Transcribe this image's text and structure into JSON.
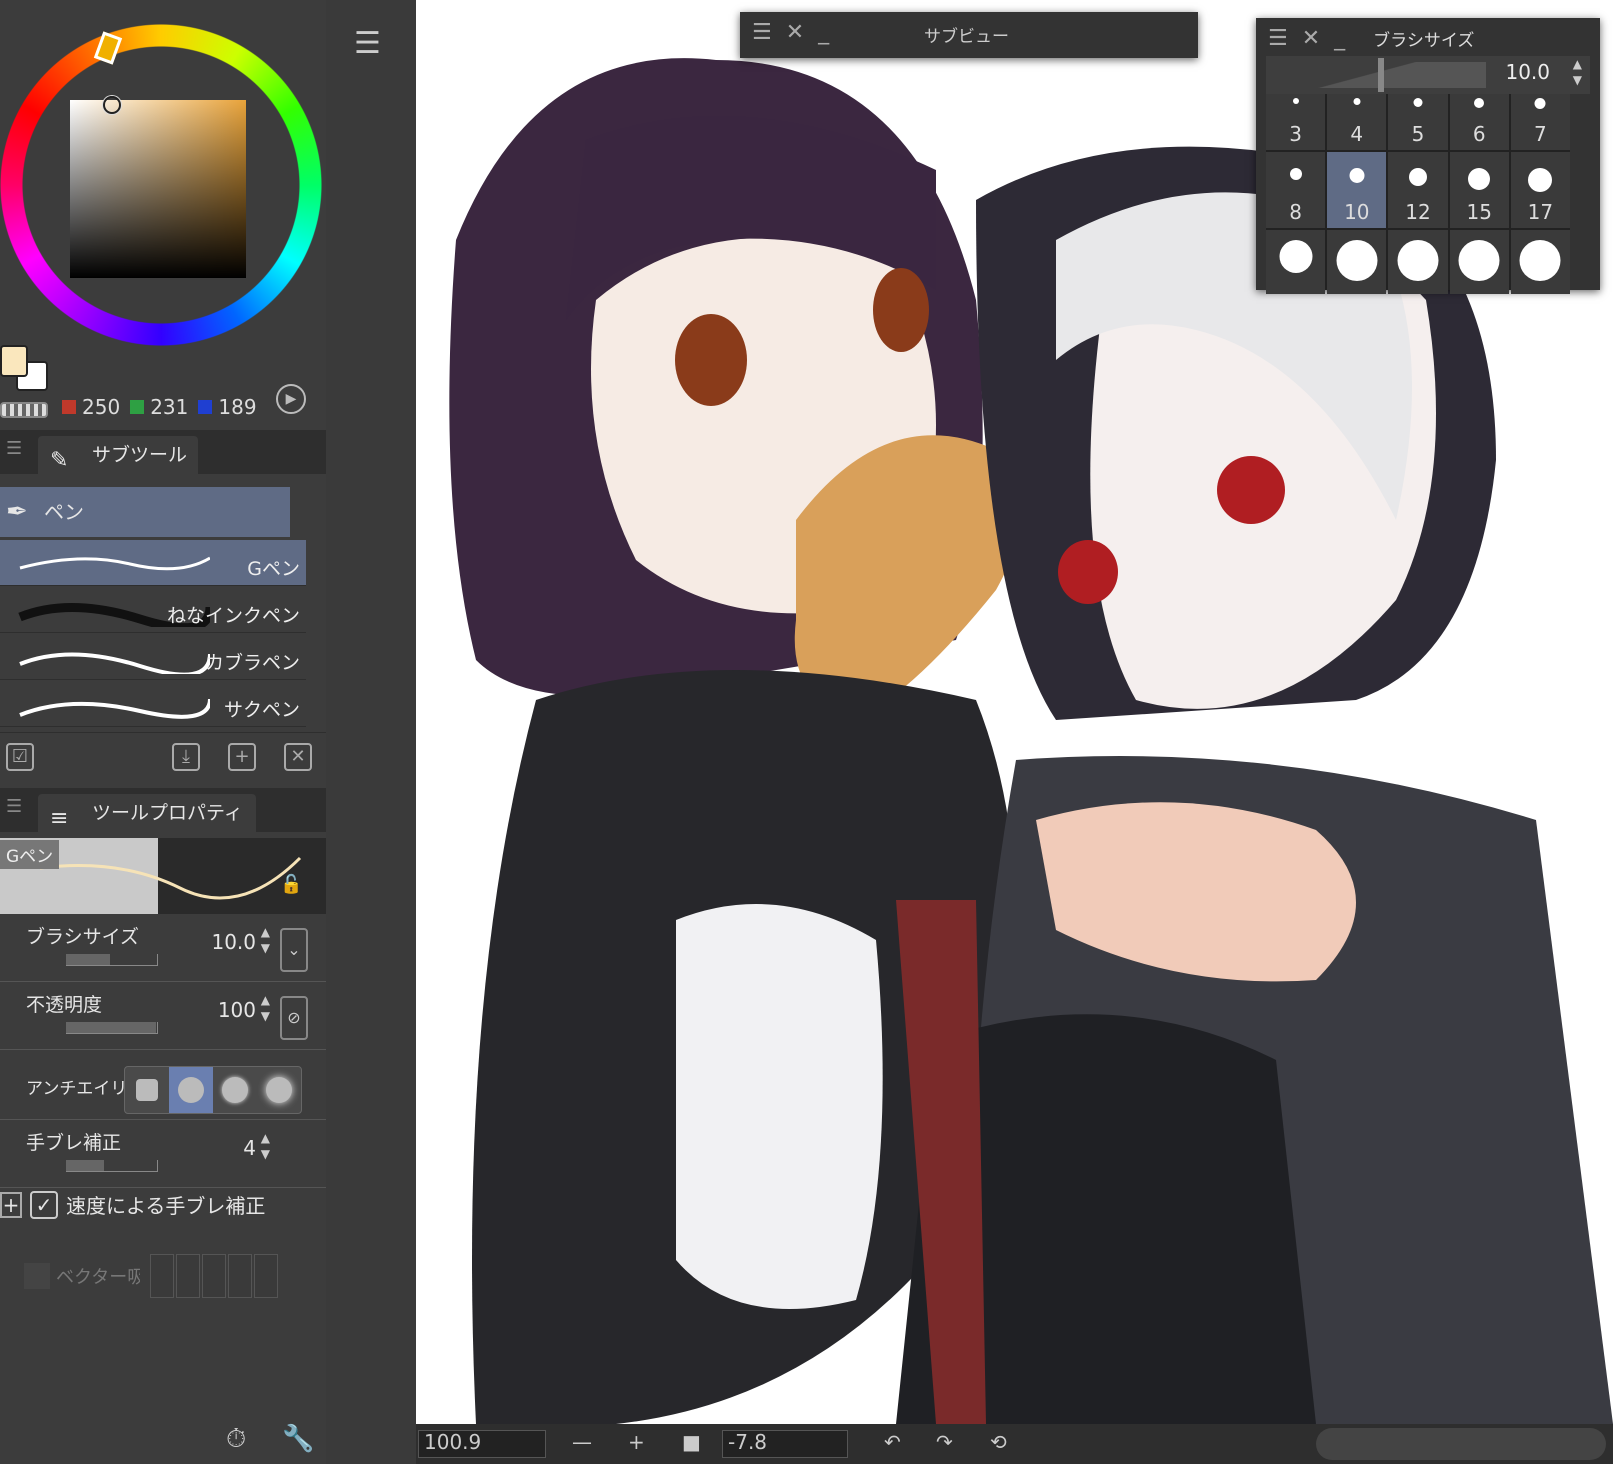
{
  "color": {
    "r_label": "250",
    "g_label": "231",
    "b_label": "189",
    "fg_hex": "#fae7bd",
    "bg_hex": "#ffffff"
  },
  "subtool": {
    "tab_label": "サブツール",
    "group_label": "ペン",
    "brushes": [
      {
        "label": "Gペン"
      },
      {
        "label": "ねなインクペン"
      },
      {
        "label": "カブラペン"
      },
      {
        "label": "サクペン"
      }
    ]
  },
  "toolprop": {
    "tab_label": "ツールプロパティ",
    "preview_label": "Gペン",
    "brush_size": {
      "label": "ブラシサイズ",
      "value": "10.0"
    },
    "opacity": {
      "label": "不透明度",
      "value": "100"
    },
    "antialias": {
      "label": "アンチエイリ"
    },
    "stabilization": {
      "label": "手ブレ補正",
      "value": "4"
    },
    "speed_stab": {
      "label": "速度による手ブレ補正"
    },
    "vector": {
      "label": "ベクター吸着"
    }
  },
  "subview": {
    "title": "サブビュー"
  },
  "brushsize_palette": {
    "title": "ブラシサイズ",
    "value": "10.0",
    "sizes": [
      "3",
      "4",
      "5",
      "6",
      "7",
      "8",
      "10",
      "12",
      "15",
      "17",
      "",
      "",
      "",
      "",
      ""
    ]
  },
  "status": {
    "zoom": "100.9",
    "rotation": "-7.8"
  },
  "accent": "#5f6b85"
}
